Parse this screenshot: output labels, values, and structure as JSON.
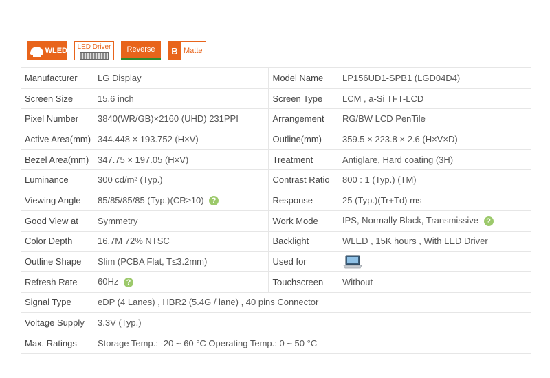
{
  "badges": {
    "wled": "WLED",
    "led_driver": "LED Driver",
    "reverse": "Reverse",
    "matte_letter": "B",
    "matte": "Matte"
  },
  "specs": {
    "manufacturer": {
      "label": "Manufacturer",
      "value": "LG Display"
    },
    "model_name": {
      "label": "Model Name",
      "value": "LP156UD1-SPB1 (LGD04D4)"
    },
    "screen_size": {
      "label": "Screen Size",
      "value": "15.6 inch"
    },
    "screen_type": {
      "label": "Screen Type",
      "value": "LCM ,   a-Si TFT-LCD"
    },
    "pixel_number": {
      "label": "Pixel Number",
      "value": "3840(WR/GB)×2160   (UHD)  231PPI"
    },
    "arrangement": {
      "label": "Arrangement",
      "value": "RG/BW LCD PenTile"
    },
    "active_area": {
      "label": "Active Area(mm)",
      "value": "344.448 × 193.752 (H×V)"
    },
    "outline": {
      "label": "Outline(mm)",
      "value": "359.5 × 223.8 × 2.6 (H×V×D)"
    },
    "bezel_area": {
      "label": "Bezel Area(mm)",
      "value": "347.75 × 197.05 (H×V)"
    },
    "treatment": {
      "label": "Treatment",
      "value": "Antiglare, Hard coating (3H)"
    },
    "luminance": {
      "label": "Luminance",
      "value": "300 cd/m² (Typ.)"
    },
    "contrast_ratio": {
      "label": "Contrast Ratio",
      "value": "800 : 1 (Typ.) (TM)"
    },
    "viewing_angle": {
      "label": "Viewing Angle",
      "value": "85/85/85/85 (Typ.)(CR≥10)"
    },
    "response": {
      "label": "Response",
      "value": "25 (Typ.)(Tr+Td) ms"
    },
    "good_view": {
      "label": "Good View at",
      "value": "Symmetry"
    },
    "work_mode": {
      "label": "Work Mode",
      "value": "IPS, Normally Black, Transmissive"
    },
    "color_depth": {
      "label": "Color Depth",
      "value": "16.7M   72% NTSC"
    },
    "backlight": {
      "label": "Backlight",
      "value": "WLED ,  15K hours , With LED Driver"
    },
    "outline_shape": {
      "label": "Outline Shape",
      "value": "Slim (PCBA Flat, T≤3.2mm)"
    },
    "used_for": {
      "label": "Used for",
      "icon": "laptop-icon"
    },
    "refresh_rate": {
      "label": "Refresh Rate",
      "value": "60Hz"
    },
    "touchscreen": {
      "label": "Touchscreen",
      "value": "Without"
    },
    "signal_type": {
      "label": "Signal Type",
      "value": "eDP (4 Lanes) , HBR2 (5.4G / lane) , 40 pins Connector"
    },
    "voltage_supply": {
      "label": "Voltage Supply",
      "value": "3.3V (Typ.)"
    },
    "max_ratings": {
      "label": "Max. Ratings",
      "value": "Storage Temp.: -20 ~ 60 °C    Operating Temp.: 0 ~ 50 °C"
    }
  },
  "help_glyph": "?",
  "colors": {
    "accent": "#e8641b",
    "help": "#9cc96b",
    "border": "#e6e6e6"
  }
}
